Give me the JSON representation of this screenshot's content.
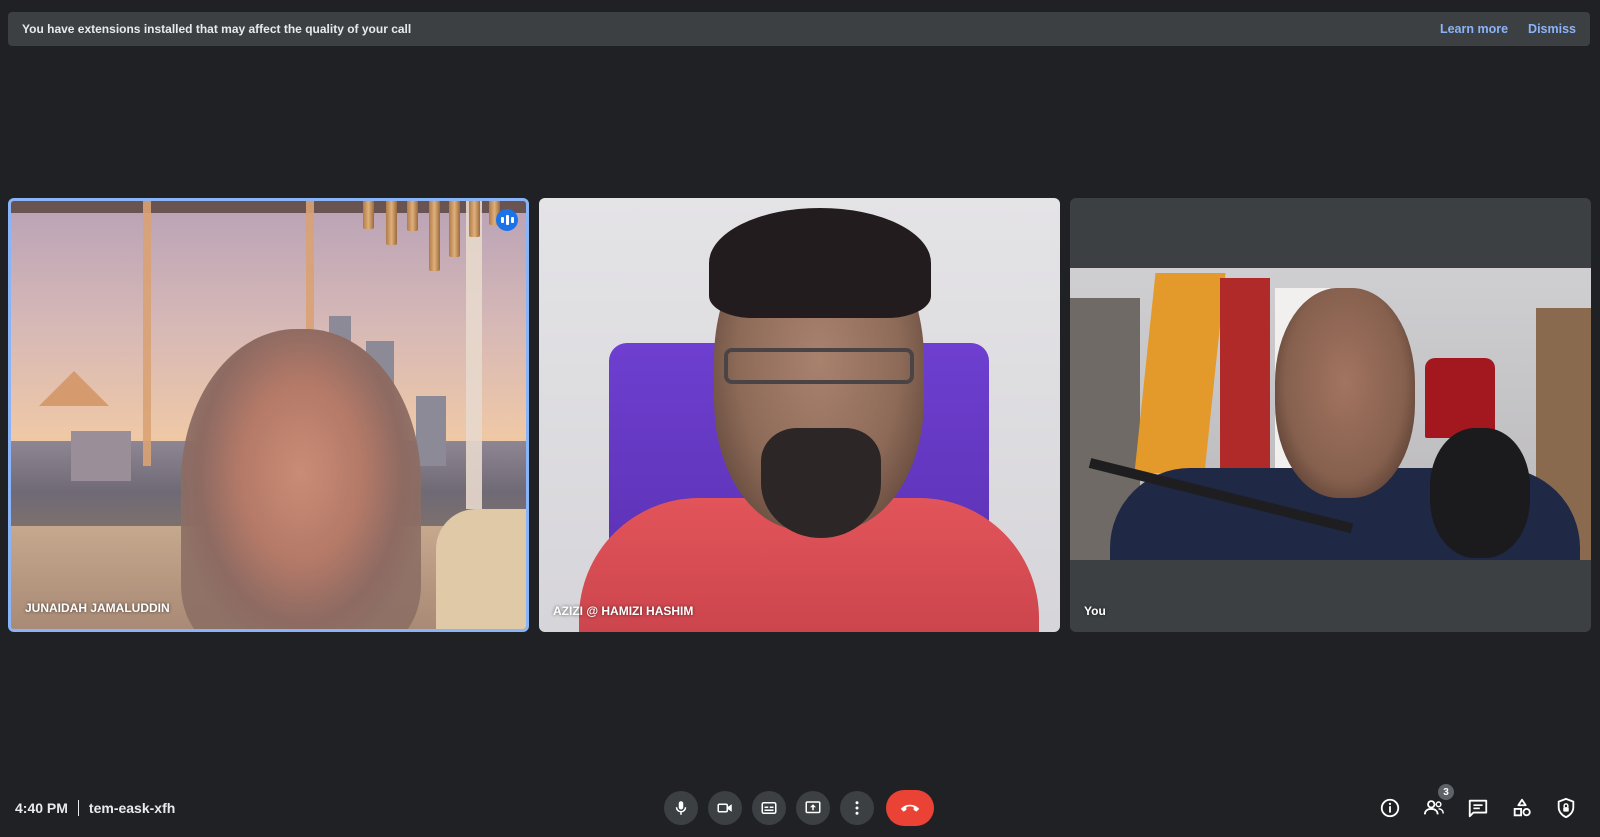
{
  "banner": {
    "message": "You have extensions installed that may affect the quality of your call",
    "learn_more": "Learn more",
    "dismiss": "Dismiss"
  },
  "participants": [
    {
      "name": "JUNAIDAH JAMALUDDIN",
      "speaking": true
    },
    {
      "name": "AZIZI @ HAMIZI HASHIM",
      "speaking": false
    },
    {
      "name": "You",
      "speaking": false
    }
  ],
  "meeting": {
    "time": "4:40 PM",
    "code": "tem-eask-xfh"
  },
  "controls": [
    {
      "icon": "microphone-icon"
    },
    {
      "icon": "camera-icon"
    },
    {
      "icon": "captions-icon"
    },
    {
      "icon": "present-screen-icon"
    },
    {
      "icon": "more-options-icon"
    },
    {
      "icon": "end-call-icon"
    }
  ],
  "side_panel": {
    "participant_count": "3",
    "icons": [
      "meeting-details-icon",
      "people-icon",
      "chat-icon",
      "activities-icon",
      "host-controls-icon"
    ]
  },
  "colors": {
    "background": "#202124",
    "banner": "#3c4043",
    "link": "#8ab4f8",
    "active_border": "#8ab4f8",
    "end_call": "#ea4335",
    "control": "#3c4043"
  }
}
